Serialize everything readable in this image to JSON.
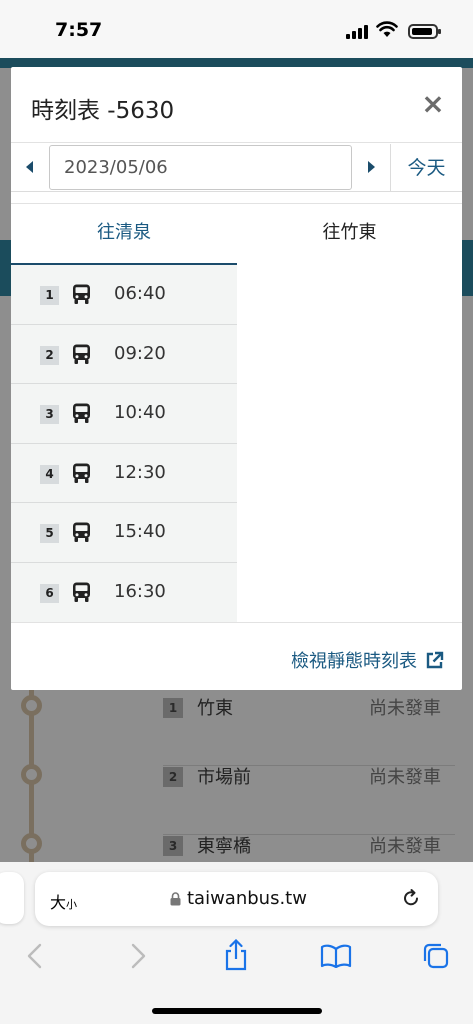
{
  "status_bar": {
    "time": "7:57"
  },
  "modal": {
    "title": "時刻表 -5630",
    "close_label": "×",
    "date": {
      "value": "2023/05/06",
      "today_label": "今天"
    },
    "tabs": [
      {
        "label": "往清泉"
      },
      {
        "label": "往竹東"
      }
    ],
    "schedule": [
      {
        "num": "1",
        "time": "06:40"
      },
      {
        "num": "2",
        "time": "09:20"
      },
      {
        "num": "3",
        "time": "10:40"
      },
      {
        "num": "4",
        "time": "12:30"
      },
      {
        "num": "5",
        "time": "15:40"
      },
      {
        "num": "6",
        "time": "16:30"
      }
    ],
    "footer_link": "檢視靜態時刻表"
  },
  "background": {
    "stops": [
      {
        "num": "1",
        "name": "竹東",
        "status": "尚未發車"
      },
      {
        "num": "2",
        "name": "市場前",
        "status": "尚未發車"
      },
      {
        "num": "3",
        "name": "東寧橋",
        "status": "尚未發車"
      }
    ]
  },
  "browser": {
    "text_size_big": "大",
    "text_size_small": "小",
    "url": "taiwanbus.tw"
  },
  "colors": {
    "accent": "#1b5a82",
    "teal": "#1b4c5c"
  }
}
